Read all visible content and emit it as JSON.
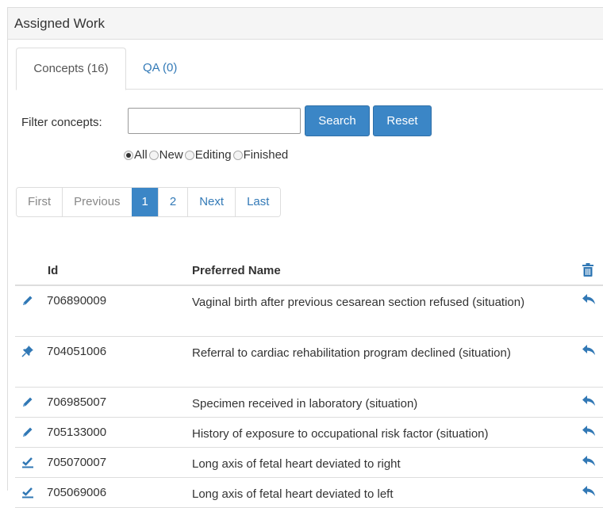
{
  "panel": {
    "title": "Assigned Work"
  },
  "tabs": [
    {
      "label": "Concepts (16)",
      "active": true
    },
    {
      "label": "QA (0)",
      "active": false
    }
  ],
  "filter": {
    "label": "Filter concepts:",
    "value": "",
    "placeholder": "",
    "search_label": "Search",
    "reset_label": "Reset",
    "options": [
      {
        "label": "All",
        "selected": true
      },
      {
        "label": "New",
        "selected": false
      },
      {
        "label": "Editing",
        "selected": false
      },
      {
        "label": "Finished",
        "selected": false
      }
    ]
  },
  "pagination": {
    "first": "First",
    "previous": "Previous",
    "pages": [
      "1",
      "2"
    ],
    "current": "1",
    "next": "Next",
    "last": "Last"
  },
  "table": {
    "headers": {
      "id": "Id",
      "name": "Preferred Name"
    },
    "header_icon": "trash-icon",
    "rows": [
      {
        "icon": "pencil-icon",
        "id": "706890009",
        "name": "Vaginal birth after previous cesarean section refused (situation)"
      },
      {
        "icon": "pushpin-icon",
        "id": "704051006",
        "name": "Referral to cardiac rehabilitation program declined (situation)"
      },
      {
        "icon": "pencil-icon",
        "id": "706985007",
        "name": "Specimen received in laboratory (situation)"
      },
      {
        "icon": "pencil-icon",
        "id": "705133000",
        "name": "History of exposure to occupational risk factor (situation)"
      },
      {
        "icon": "check-icon",
        "id": "705070007",
        "name": "Long axis of fetal heart deviated to right"
      },
      {
        "icon": "check-icon",
        "id": "705069006",
        "name": "Long axis of fetal heart deviated to left"
      }
    ],
    "action_icon": "share-reply-icon"
  },
  "colors": {
    "accent": "#3b86c6",
    "link": "#337ab7",
    "icon": "#3178b5"
  }
}
